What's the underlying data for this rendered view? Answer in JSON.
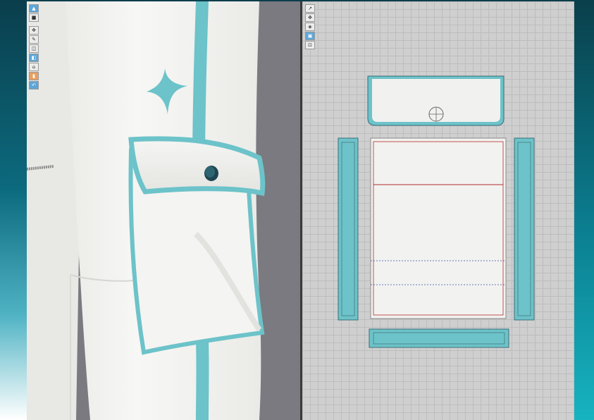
{
  "colors": {
    "accent_teal": "#6cc3c9",
    "garment_white": "#f4f4f2",
    "viewport3d_bg": "#7a7a80",
    "viewport2d_bg": "#cfcfcf",
    "grid_line": "#bdbdbd",
    "seam_red": "#b02a2a",
    "seam_blue": "#3a52a8"
  },
  "left_toolbar": {
    "tools": [
      {
        "icon": "avatar-display-icon"
      },
      {
        "icon": "garment-display-icon"
      },
      {
        "icon": "select-move-icon"
      },
      {
        "icon": "pin-icon"
      },
      {
        "icon": "fold-arrangement-icon"
      },
      {
        "icon": "sewing-icon"
      },
      {
        "icon": "steam-icon"
      },
      {
        "icon": "brush-icon"
      },
      {
        "icon": "undo-icon"
      }
    ]
  },
  "right_toolbar": {
    "tools": [
      {
        "icon": "transform-pattern-icon"
      },
      {
        "icon": "edit-point-icon"
      },
      {
        "icon": "polygon-icon"
      },
      {
        "icon": "internal-shape-icon"
      },
      {
        "icon": "lock-icon"
      }
    ]
  }
}
